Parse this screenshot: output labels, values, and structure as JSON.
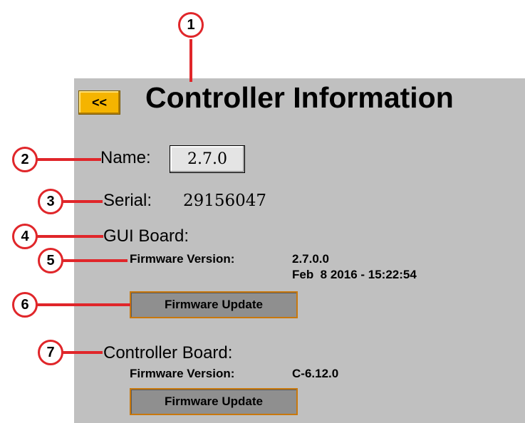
{
  "header": {
    "back_label": "<<",
    "title": "Controller Information"
  },
  "name": {
    "label": "Name:",
    "value": "2.7.0"
  },
  "serial": {
    "label": "Serial:",
    "value": "29156047"
  },
  "gui_board": {
    "heading": "GUI Board:",
    "firmware_label": "Firmware Version:",
    "firmware_version": "2.7.0.0",
    "build_date": "Feb  8 2016 - 15:22:54",
    "update_button": "Firmware Update"
  },
  "controller_board": {
    "heading": "Controller Board:",
    "firmware_label": "Firmware Version:",
    "firmware_version": "C-6.12.0",
    "update_button": "Firmware Update"
  },
  "callouts": [
    "1",
    "2",
    "3",
    "4",
    "5",
    "6",
    "7"
  ],
  "colors": {
    "panel": "#c0c0c0",
    "back_button": "#f5b400",
    "callout": "#e0262a",
    "button_border": "#c8780d"
  }
}
